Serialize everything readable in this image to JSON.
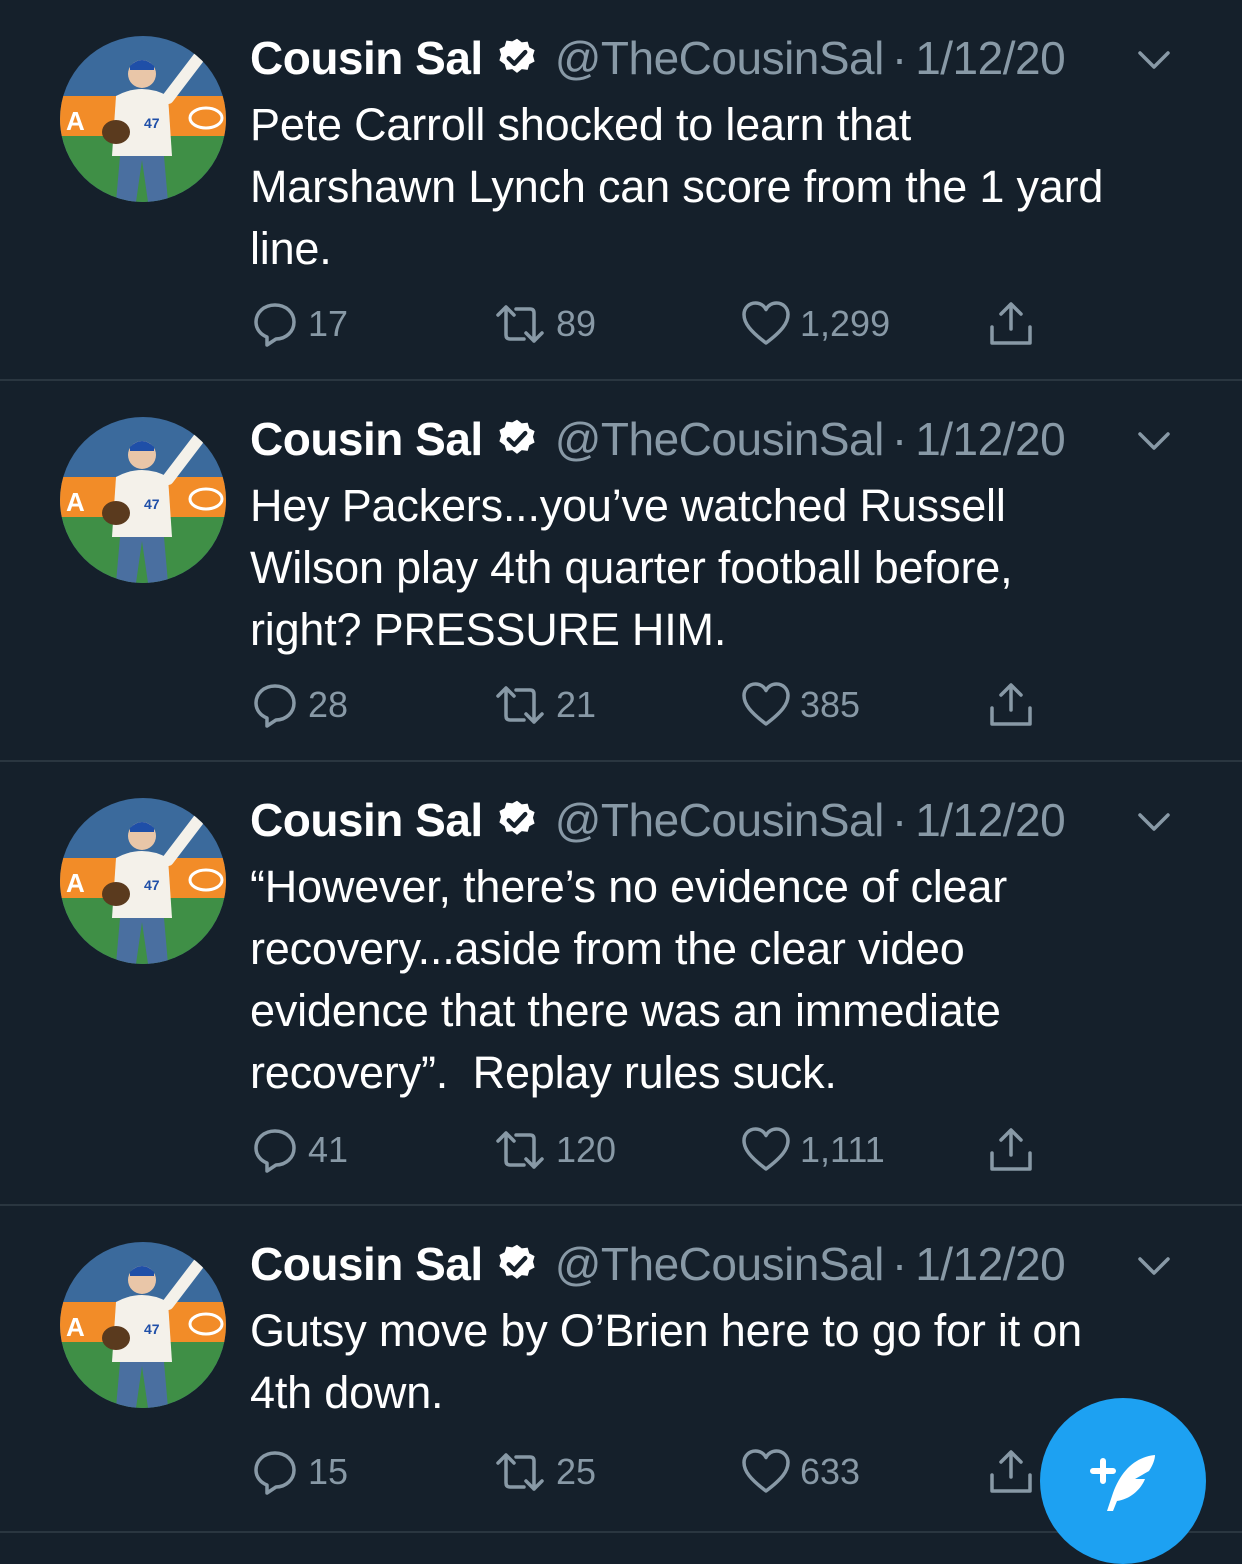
{
  "tweets": [
    {
      "name": "Cousin Sal",
      "handle": "@TheCousinSal",
      "separator": "·",
      "date": "1/12/20",
      "text": "Pete Carroll shocked to learn that\nMarshawn Lynch can score from the 1 yard\nline.",
      "replies": "17",
      "retweets": "89",
      "likes": "1,299"
    },
    {
      "name": "Cousin Sal",
      "handle": "@TheCousinSal",
      "separator": "·",
      "date": "1/12/20",
      "text": "Hey Packers...you’ve watched Russell\nWilson play 4th quarter football before,\nright? PRESSURE HIM.",
      "replies": "28",
      "retweets": "21",
      "likes": "385"
    },
    {
      "name": "Cousin Sal",
      "handle": "@TheCousinSal",
      "separator": "·",
      "date": "1/12/20",
      "text": "“However, there’s no evidence of clear\nrecovery...aside from the clear video\nevidence that there was an immediate\nrecovery”.  Replay rules suck.",
      "replies": "41",
      "retweets": "120",
      "likes": "1,111"
    },
    {
      "name": "Cousin Sal",
      "handle": "@TheCousinSal",
      "separator": "·",
      "date": "1/12/20",
      "text": "Gutsy move by O’Brien here to go for it on\n4th down.",
      "replies": "15",
      "retweets": "25",
      "likes": "633"
    }
  ],
  "icons": {
    "avatar": "avatar-photo",
    "verified": "verified-badge-icon",
    "caret": "chevron-down-icon",
    "reply": "reply-icon",
    "retweet": "retweet-icon",
    "like": "heart-icon",
    "share": "share-icon",
    "compose": "compose-tweet-icon"
  },
  "colors": {
    "background": "#15202b",
    "text": "#ffffff",
    "muted": "#8899a6",
    "divider": "#2a3640",
    "accent": "#1da1f2"
  }
}
